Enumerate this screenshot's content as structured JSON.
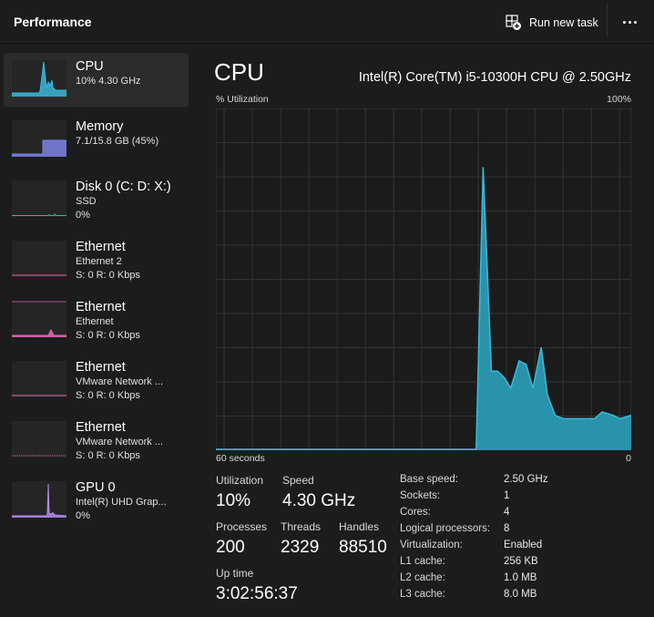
{
  "header": {
    "title": "Performance",
    "run_new_task": "Run new task",
    "more_icon": "more-dots-icon"
  },
  "sidebar": {
    "items": [
      {
        "title": "CPU",
        "sub1": "10% 4.30 GHz",
        "sub2": "",
        "selected": true,
        "color": "#3bb9d9",
        "type": "cpu"
      },
      {
        "title": "Memory",
        "sub1": "7.1/15.8 GB (45%)",
        "sub2": "",
        "selected": false,
        "color": "#7b83e8",
        "type": "memory"
      },
      {
        "title": "Disk 0 (C: D: X:)",
        "sub1": "SSD",
        "sub2": "0%",
        "selected": false,
        "color": "#3bb98d",
        "type": "disk"
      },
      {
        "title": "Ethernet",
        "sub1": "Ethernet 2",
        "sub2": "S: 0 R: 0 Kbps",
        "selected": false,
        "color": "#e36ab6",
        "type": "eth1"
      },
      {
        "title": "Ethernet",
        "sub1": "Ethernet",
        "sub2": "S: 0 R: 0 Kbps",
        "selected": false,
        "color": "#e36ab6",
        "type": "eth2"
      },
      {
        "title": "Ethernet",
        "sub1": "VMware Network ...",
        "sub2": "S: 0 R: 0 Kbps",
        "selected": false,
        "color": "#e36ab6",
        "type": "eth3"
      },
      {
        "title": "Ethernet",
        "sub1": "VMware Network ...",
        "sub2": "S: 0 R: 0 Kbps",
        "selected": false,
        "color": "#e36ab6",
        "type": "eth4"
      },
      {
        "title": "GPU 0",
        "sub1": "Intel(R) UHD Grap...",
        "sub2": "0%",
        "selected": false,
        "color": "#b58ae8",
        "type": "gpu"
      }
    ]
  },
  "main": {
    "title": "CPU",
    "model": "Intel(R) Core(TM) i5-10300H CPU @ 2.50GHz",
    "y_label": "% Utilization",
    "y_max_label": "100%",
    "x_left_label": "60 seconds",
    "x_right_label": "0",
    "stats": {
      "utilization_label": "Utilization",
      "utilization": "10%",
      "speed_label": "Speed",
      "speed": "4.30 GHz",
      "processes_label": "Processes",
      "processes": "200",
      "threads_label": "Threads",
      "threads": "2329",
      "handles_label": "Handles",
      "handles": "88510",
      "uptime_label": "Up time",
      "uptime": "3:02:56:37"
    },
    "specs": [
      {
        "label": "Base speed:",
        "value": "2.50 GHz"
      },
      {
        "label": "Sockets:",
        "value": "1"
      },
      {
        "label": "Cores:",
        "value": "4"
      },
      {
        "label": "Logical processors:",
        "value": "8"
      },
      {
        "label": "Virtualization:",
        "value": "Enabled"
      },
      {
        "label": "L1 cache:",
        "value": "256 KB"
      },
      {
        "label": "L2 cache:",
        "value": "1.0 MB"
      },
      {
        "label": "L3 cache:",
        "value": "8.0 MB"
      }
    ]
  },
  "chart_data": {
    "type": "area",
    "title": "CPU",
    "xlabel": "60 seconds",
    "ylabel": "% Utilization",
    "xlim": [
      60,
      0
    ],
    "ylim": [
      0,
      100
    ],
    "grid": true,
    "color": "#3bb9d9",
    "fill": "#2a93ac",
    "x_seconds_ago": [
      60,
      22.4,
      21.4,
      20.2,
      19.3,
      18.3,
      17.4,
      16.2,
      15.2,
      14.2,
      13.0,
      12.1,
      11.0,
      9.8,
      8.1,
      6.8,
      5.3,
      4.2,
      2.6,
      1.6,
      0
    ],
    "values": [
      0,
      0,
      83,
      23,
      23,
      21,
      18,
      26,
      25,
      18,
      30,
      16,
      10,
      9,
      9,
      9,
      9,
      11,
      10,
      9,
      10
    ]
  }
}
